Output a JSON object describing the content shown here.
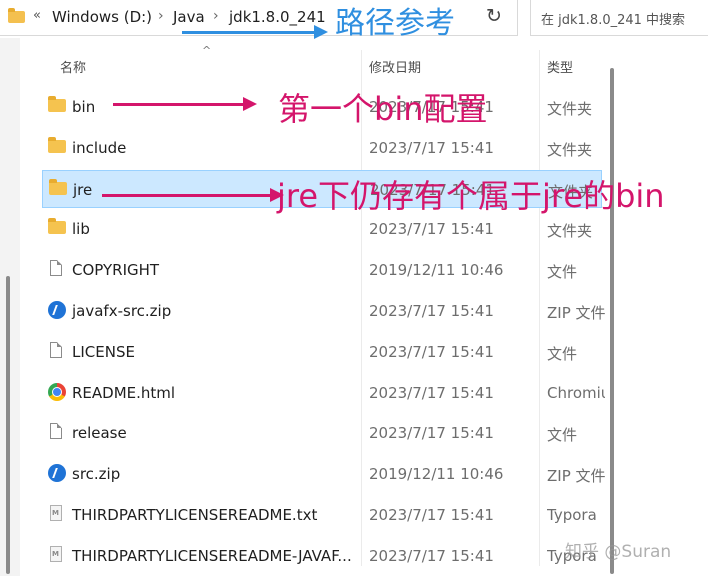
{
  "address": {
    "overflow_glyph": "«",
    "breadcrumbs": [
      "Windows (D:)",
      "Java",
      "jdk1.8.0_241"
    ],
    "separator": "›",
    "refresh_glyph": "↻"
  },
  "search": {
    "placeholder": "在 jdk1.8.0_241 中搜索"
  },
  "columns": {
    "name": "名称",
    "date": "修改日期",
    "type": "类型"
  },
  "files": [
    {
      "name": "bin",
      "date": "2023/7/17 15:41",
      "type": "文件夹",
      "icon": "folder-icon"
    },
    {
      "name": "include",
      "date": "2023/7/17 15:41",
      "type": "文件夹",
      "icon": "folder-icon"
    },
    {
      "name": "jre",
      "date": "2023/7/17 15:41",
      "type": "文件夹",
      "icon": "folder-icon",
      "selected": true
    },
    {
      "name": "lib",
      "date": "2023/7/17 15:41",
      "type": "文件夹",
      "icon": "folder-icon"
    },
    {
      "name": "COPYRIGHT",
      "date": "2019/12/11 10:46",
      "type": "文件",
      "icon": "file-icon"
    },
    {
      "name": "javafx-src.zip",
      "date": "2023/7/17 15:41",
      "type": "ZIP 文件",
      "icon": "zip-icon"
    },
    {
      "name": "LICENSE",
      "date": "2023/7/17 15:41",
      "type": "文件",
      "icon": "file-icon"
    },
    {
      "name": "README.html",
      "date": "2023/7/17 15:41",
      "type": "Chromium",
      "icon": "chrome-icon"
    },
    {
      "name": "release",
      "date": "2023/7/17 15:41",
      "type": "文件",
      "icon": "file-icon"
    },
    {
      "name": "src.zip",
      "date": "2019/12/11 10:46",
      "type": "ZIP 文件",
      "icon": "zip-icon"
    },
    {
      "name": "THIRDPARTYLICENSEREADME.txt",
      "date": "2023/7/17 15:41",
      "type": "Typora",
      "icon": "typora-icon"
    },
    {
      "name": "THIRDPARTYLICENSEREADME-JAVAF...",
      "date": "2023/7/17 15:41",
      "type": "Typora",
      "icon": "typora-icon"
    }
  ],
  "annotations": {
    "path": "路径参考",
    "bin": "第一个bin配置",
    "jre": "jre下仍存有个属于jre的bin"
  },
  "colors": {
    "annotation": "#d4156b",
    "path_annotation": "#2f8fe0",
    "selection": "#cce8ff"
  },
  "watermark": "知乎 @Suran"
}
